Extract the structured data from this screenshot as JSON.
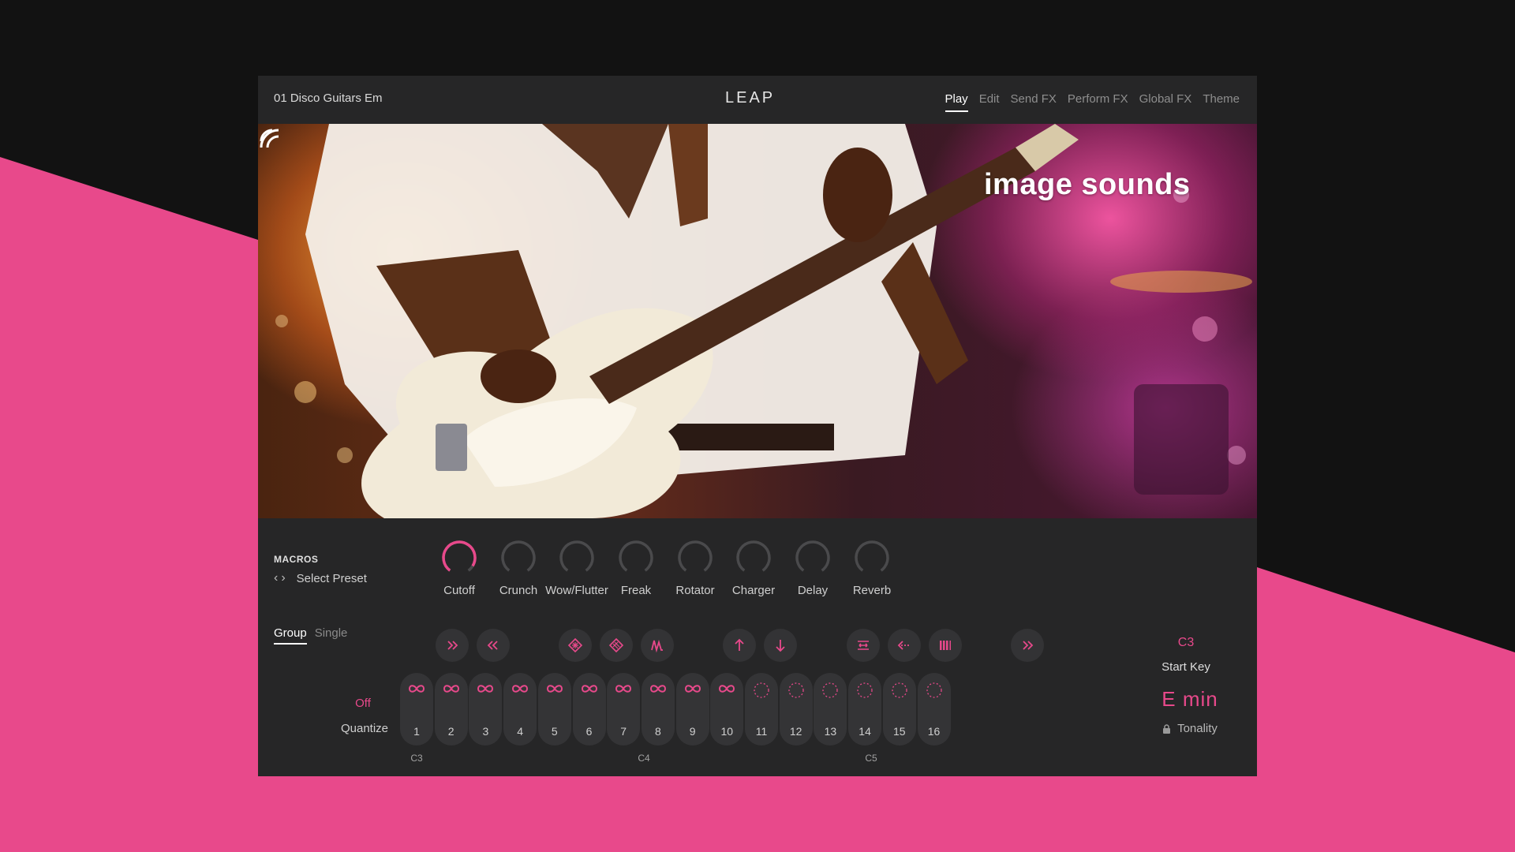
{
  "header": {
    "preset_name": "01 Disco Guitars Em",
    "logo": "LEAP",
    "nav": [
      {
        "label": "Play",
        "active": true
      },
      {
        "label": "Edit",
        "active": false
      },
      {
        "label": "Send FX",
        "active": false
      },
      {
        "label": "Perform FX",
        "active": false
      },
      {
        "label": "Global FX",
        "active": false
      },
      {
        "label": "Theme",
        "active": false
      }
    ]
  },
  "hero": {
    "brand": "image sounds"
  },
  "macros": {
    "label": "MACROS",
    "select_label": "Select Preset",
    "knobs": [
      {
        "label": "Cutoff",
        "value": 0.92
      },
      {
        "label": "Crunch",
        "value": 0.0
      },
      {
        "label": "Wow/Flutter",
        "value": 0.0
      },
      {
        "label": "Freak",
        "value": 0.0
      },
      {
        "label": "Rotator",
        "value": 0.0
      },
      {
        "label": "Charger",
        "value": 0.0
      },
      {
        "label": "Delay",
        "value": 0.0
      },
      {
        "label": "Reverb",
        "value": 0.0
      }
    ]
  },
  "mode_tabs": [
    {
      "label": "Group",
      "active": true
    },
    {
      "label": "Single",
      "active": false
    }
  ],
  "quantize": {
    "value": "Off",
    "label": "Quantize"
  },
  "pads": [
    {
      "num": "1",
      "type": "loop"
    },
    {
      "num": "2",
      "type": "loop"
    },
    {
      "num": "3",
      "type": "loop"
    },
    {
      "num": "4",
      "type": "loop"
    },
    {
      "num": "5",
      "type": "loop"
    },
    {
      "num": "6",
      "type": "loop"
    },
    {
      "num": "7",
      "type": "loop"
    },
    {
      "num": "8",
      "type": "loop"
    },
    {
      "num": "9",
      "type": "loop"
    },
    {
      "num": "10",
      "type": "loop"
    },
    {
      "num": "11",
      "type": "empty"
    },
    {
      "num": "12",
      "type": "empty"
    },
    {
      "num": "13",
      "type": "empty"
    },
    {
      "num": "14",
      "type": "empty"
    },
    {
      "num": "15",
      "type": "empty"
    },
    {
      "num": "16",
      "type": "empty"
    }
  ],
  "key_labels": [
    "C3",
    "C4",
    "C5"
  ],
  "start_key": {
    "value": "C3",
    "label": "Start Key"
  },
  "tonality": {
    "value": "E  min",
    "label": "Tonality"
  },
  "colors": {
    "accent": "#e8498b",
    "panel": "#262627",
    "background": "#121212"
  },
  "icons": {
    "ctrl_buttons": [
      "fast-forward-icon",
      "rewind-icon",
      "grid-pattern-icon",
      "grid-pattern-alt-icon",
      "waveform-icon",
      "arrow-up-icon",
      "arrow-down-icon",
      "swap-icon",
      "dotted-arrow-left-icon",
      "bars-icon",
      "fast-forward-icon"
    ]
  }
}
